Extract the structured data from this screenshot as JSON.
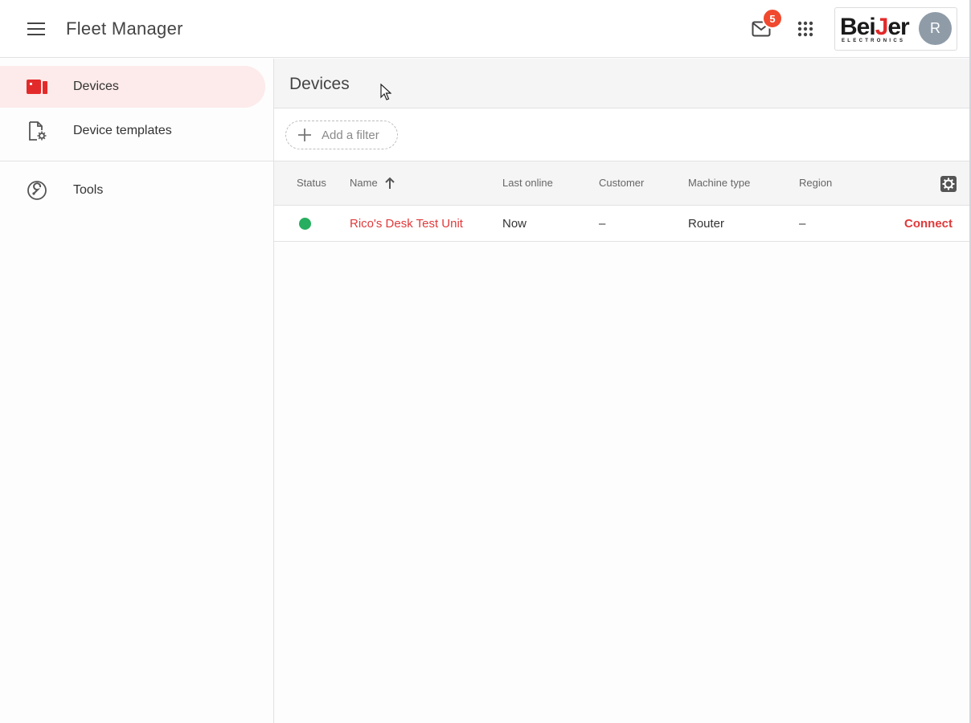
{
  "app": {
    "title": "Fleet Manager"
  },
  "header": {
    "notifications_count": "5",
    "brand": {
      "name_pre": "Bei",
      "name_j": "J",
      "name_post": "er",
      "subtitle": "ELECTRONICS"
    },
    "avatar_initial": "R"
  },
  "sidebar": {
    "items": [
      {
        "label": "Devices",
        "icon": "devices-icon",
        "active": true
      },
      {
        "label": "Device templates",
        "icon": "device-template-icon",
        "active": false
      },
      {
        "label": "Tools",
        "icon": "tools-icon",
        "active": false
      }
    ]
  },
  "main": {
    "title": "Devices",
    "add_filter_label": "Add a filter",
    "table": {
      "columns": [
        "Status",
        "Name",
        "Last online",
        "Customer",
        "Machine type",
        "Region"
      ],
      "sort": {
        "column": "Name",
        "direction": "ascending"
      },
      "rows": [
        {
          "status": "online",
          "name": "Rico's Desk Test Unit",
          "last_online": "Now",
          "customer": "–",
          "machine_type": "Router",
          "region": "–",
          "action": "Connect"
        }
      ]
    }
  },
  "colors": {
    "accent": "#e0393a",
    "online": "#27ae60",
    "badge": "#f0492e",
    "active_nav_bg": "#fdeaea"
  }
}
